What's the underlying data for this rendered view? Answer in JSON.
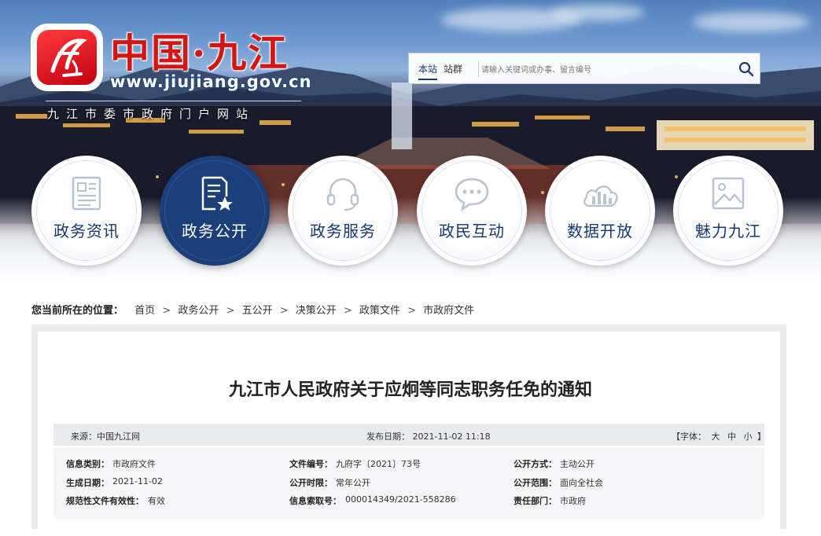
{
  "header": {
    "title": "中国·九江",
    "url": "www.jiujiang.gov.cn",
    "subtitle": "九江市委市政府门户网站"
  },
  "search": {
    "scopes": [
      "本站",
      "站群"
    ],
    "active_scope": "本站",
    "placeholder": "请输入关键词或办事、留言编号"
  },
  "nav": [
    {
      "label": "政务资讯",
      "icon": "newspaper-icon"
    },
    {
      "label": "政务公开",
      "icon": "document-star-icon",
      "active": true
    },
    {
      "label": "政务服务",
      "icon": "headset-icon"
    },
    {
      "label": "政民互动",
      "icon": "chat-bubble-icon"
    },
    {
      "label": "数据开放",
      "icon": "bar-chart-cloud-icon"
    },
    {
      "label": "魅力九江",
      "icon": "image-icon"
    }
  ],
  "breadcrumb": {
    "lead": "您当前所在的位置：",
    "items": [
      "首页",
      "政务公开",
      "五公开",
      "决策公开",
      "政策文件",
      "市政府文件"
    ],
    "separator": ">"
  },
  "article": {
    "title": "九江市人民政府关于应炯等同志职务任免的通知",
    "source": "来源：中国九江网",
    "date": "发布日期： 2021-11-02 11:18",
    "font_prefix": "【字体：",
    "font_sizes": [
      "大",
      "中",
      "小"
    ],
    "font_suffix": "】"
  },
  "info": {
    "category_label": "信息类别：",
    "category": "市政府文件",
    "doc_no_label": "文件编号：",
    "doc_no": "九府字〔2021〕73号",
    "open_mode_label": "公开方式：",
    "open_mode": "主动公开",
    "gen_date_label": "生成日期：",
    "gen_date": "2021-11-02",
    "open_period_label": "公开时限：",
    "open_period": "常年公开",
    "open_scope_label": "公开范围：",
    "open_scope": "面向全社会",
    "validity_label": "规范性文件有效性：",
    "validity": "有效",
    "index_label": "信息索取号：",
    "index": "000014349/2021-558286",
    "dept_label": "责任部门：",
    "dept": "市政府"
  },
  "colors": {
    "brand_red": "#d51414",
    "nav_active": "#1c3f7a",
    "nav_text": "#14386e"
  }
}
